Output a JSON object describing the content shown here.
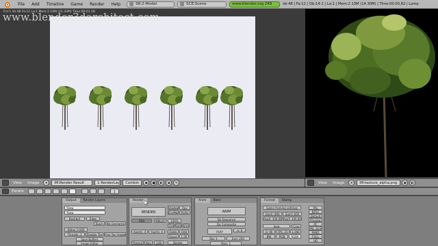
{
  "topbar": {
    "menus": [
      "File",
      "Add",
      "Timeline",
      "Game",
      "Render",
      "Help"
    ],
    "screen": "SR:2-Model",
    "scene": "SCE:Scene",
    "url": "www.blender.org 249",
    "stats": "Ve:48 | Fa:12 | Ob:14-1 | La:1 | Mem:2.13M (14.30M) | Time:00:00.82 | Lamp"
  },
  "watermark": "www.blender3darchitect.com",
  "frameinfo": "Fra:1  Ve:48 Fa:12 La:1  Mem:2.14M (21.43M) Time:00:01.18",
  "left_header": {
    "view": "View",
    "image": "Image",
    "image_name": "IM:Render Result",
    "render_layer": "1 RenderLay",
    "pass": "Combin"
  },
  "right_header": {
    "view": "View",
    "image": "Image",
    "image_name": "IM:texture_alpha.png"
  },
  "buttons_header": {
    "panels": "Panels",
    "frame": "1"
  },
  "panels": {
    "output": {
      "tabs": [
        "Output",
        "Render Layers"
      ],
      "buttons": [
        "Ykew",
        "Ykew",
        "Backbuf",
        "Edge",
        "Touch",
        "No Overwrite",
        "Dither 0.000",
        "Threads: 2",
        "Disable Tex",
        "Free Tex Images",
        "Save Buffers",
        "Image Editor"
      ]
    },
    "render": {
      "tabs": [
        "Render"
      ],
      "buttons": [
        "RENDER",
        "Shadow",
        "EnvMap",
        "Ray",
        "Radio",
        "OSA",
        "MBLUR",
        "100%",
        "75%",
        "50%",
        "25%",
        "Xparts: 4",
        "Yparts: 4",
        "Fields",
        "Odd",
        "Gauss",
        "1.00",
        "Premul",
        "Key",
        "128",
        "Border"
      ]
    },
    "anim": {
      "tabs": [
        "Anim",
        "Bake"
      ],
      "buttons": [
        "ANIM",
        "Do Sequence",
        "Do Composite",
        "PLAY",
        "rt: 0",
        "Sta: 1",
        "End: 250",
        "Step: 1"
      ]
    },
    "format": {
      "tabs": [
        "Format",
        "Stamp"
      ],
      "buttons": [
        "Game framing settings",
        "SizeX: 800",
        "SizeY: 600",
        "AspX: 100.00",
        "AspY: 100.00",
        "Jpeg",
        "Crop",
        "Q: 90",
        "FPS: 25",
        "1.000",
        "BW",
        "RGB",
        "RGBA"
      ],
      "presets": [
        "PAL",
        "NTSC",
        "Default",
        "Preview",
        "PC",
        "PAL 16:9",
        "PANO",
        "FULL",
        "HD"
      ]
    }
  }
}
